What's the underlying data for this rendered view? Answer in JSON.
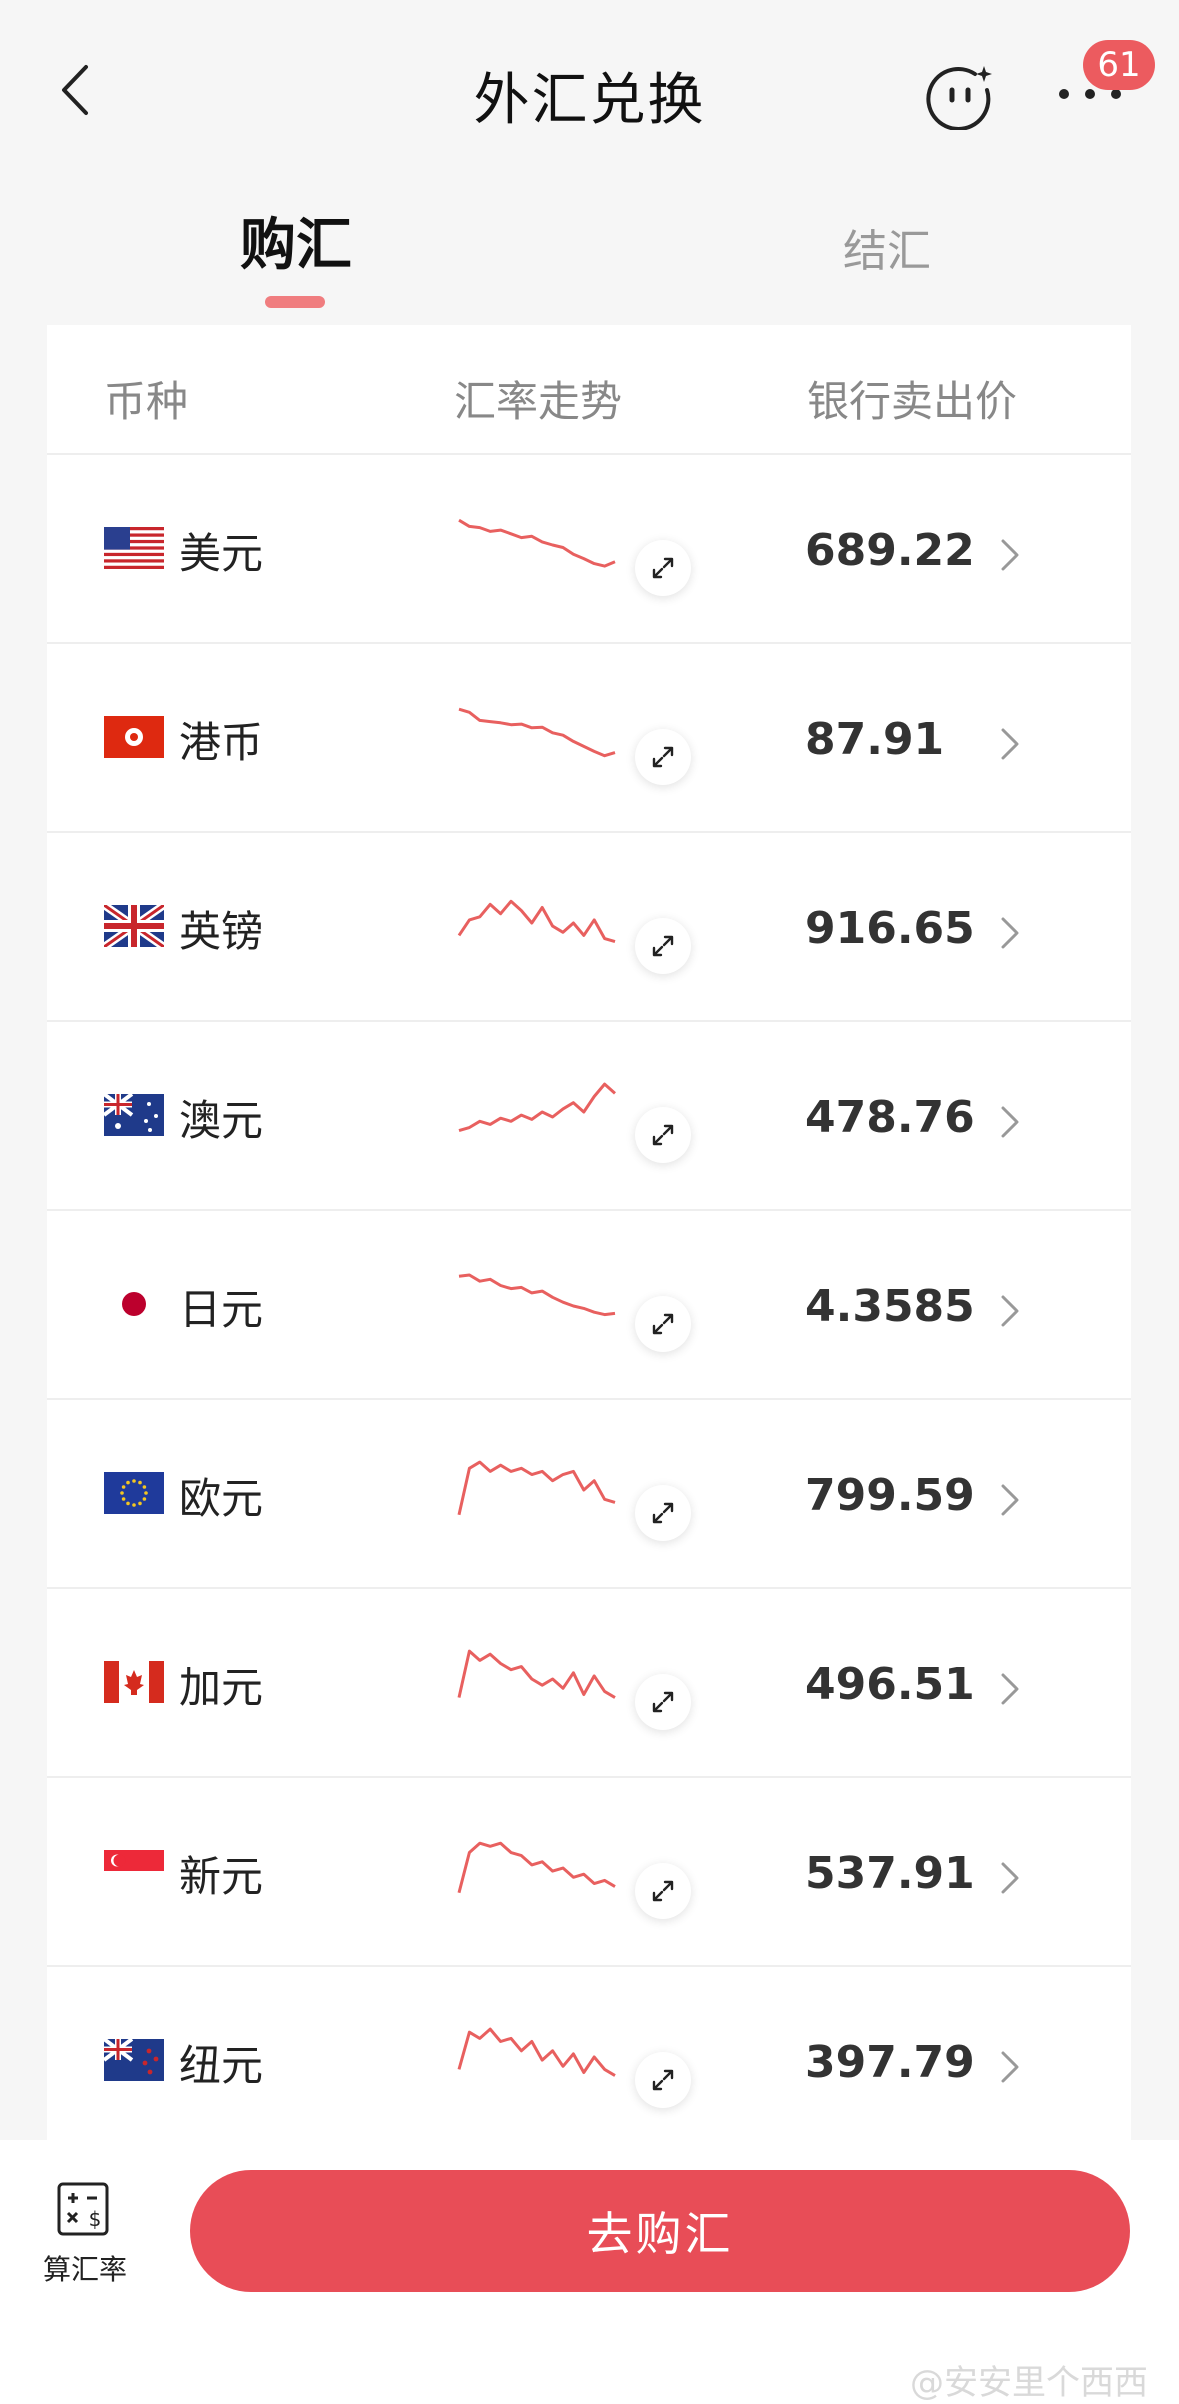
{
  "header": {
    "title": "外汇兑换",
    "badge_count": "61"
  },
  "tabs": [
    {
      "label": "购汇",
      "active": true
    },
    {
      "label": "结汇",
      "active": false
    }
  ],
  "table": {
    "headers": {
      "currency": "币种",
      "trend": "汇率走势",
      "price": "银行卖出价"
    },
    "rows": [
      {
        "name": "美元",
        "price": "689.22",
        "flag": "us-flag",
        "trend": [
          9,
          8,
          7.8,
          7.2,
          7.4,
          6.8,
          6.2,
          6.4,
          5.5,
          5.0,
          4.6,
          3.5,
          2.8,
          2.0,
          1.6,
          2.3
        ]
      },
      {
        "name": "港币",
        "price": "87.91",
        "flag": "hk-flag",
        "trend": [
          9,
          8.5,
          7.2,
          7.0,
          6.8,
          6.5,
          6.6,
          6.0,
          6.1,
          5.2,
          4.8,
          3.8,
          3.0,
          2.2,
          1.5,
          2.0
        ]
      },
      {
        "name": "英镑",
        "price": "916.65",
        "flag": "uk-flag",
        "trend": [
          3,
          5.5,
          6.0,
          8.0,
          6.5,
          8.5,
          7.0,
          5.0,
          7.5,
          4.5,
          3.5,
          5.0,
          3.0,
          5.5,
          2.5,
          2.0
        ]
      },
      {
        "name": "澳元",
        "price": "478.76",
        "flag": "au-flag",
        "trend": [
          2,
          2.5,
          3.5,
          3.0,
          4.0,
          3.5,
          4.5,
          3.8,
          5.0,
          4.2,
          5.5,
          6.5,
          5.0,
          7.5,
          9.5,
          8.0
        ]
      },
      {
        "name": "日元",
        "price": "4.3585",
        "flag": "jp-flag",
        "trend": [
          9,
          9.2,
          8.2,
          8.5,
          7.5,
          7.0,
          7.2,
          6.3,
          6.6,
          5.6,
          4.8,
          4.2,
          3.8,
          3.2,
          2.8,
          3.0
        ]
      },
      {
        "name": "欧元",
        "price": "799.59",
        "flag": "eu-flag",
        "trend": [
          1,
          8.5,
          9.5,
          8.0,
          9.0,
          8.0,
          8.5,
          7.5,
          8.0,
          6.5,
          7.5,
          8.0,
          5.0,
          6.5,
          3.5,
          3.0
        ]
      },
      {
        "name": "加元",
        "price": "496.51",
        "flag": "ca-flag",
        "trend": [
          2,
          9.5,
          8.0,
          9.0,
          7.5,
          6.5,
          7.0,
          5.0,
          4.0,
          5.0,
          3.5,
          6.0,
          2.5,
          5.5,
          3.0,
          2.0
        ]
      },
      {
        "name": "新元",
        "price": "537.91",
        "flag": "sg-flag",
        "trend": [
          1,
          7.5,
          9.0,
          8.5,
          9.0,
          7.5,
          7.0,
          5.5,
          6.0,
          4.5,
          5.0,
          3.5,
          4.0,
          2.5,
          3.0,
          2.0
        ]
      },
      {
        "name": "纽元",
        "price": "397.79",
        "flag": "nz-flag",
        "trend": [
          3,
          9.0,
          8.0,
          9.5,
          7.5,
          8.0,
          6.0,
          7.5,
          4.5,
          6.0,
          3.5,
          5.5,
          2.5,
          5.0,
          3.0,
          2.0
        ]
      }
    ]
  },
  "bottom": {
    "calc_label": "算汇率",
    "go_label": "去购汇"
  },
  "watermark": "@安安里个西西",
  "colors": {
    "accent": "#e84d57",
    "badge": "#ec5b5f",
    "trend_line": "#e8605f"
  }
}
